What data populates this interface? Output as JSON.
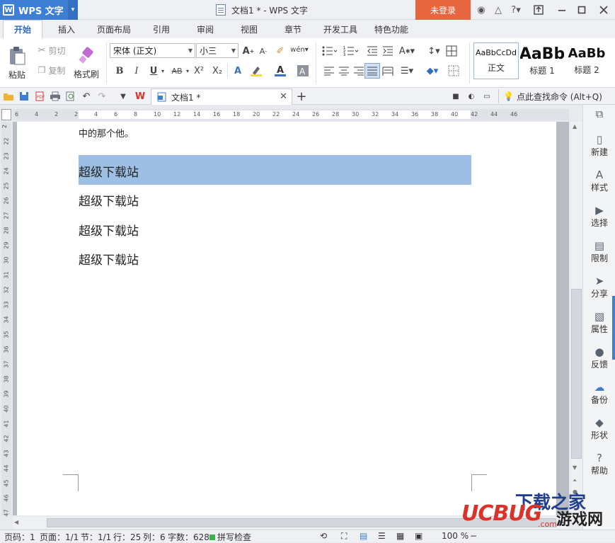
{
  "app": {
    "name": "WPS 文字",
    "doc_title": "文档1 * - WPS 文字",
    "login": "未登录"
  },
  "title_icons": [
    "shirt-icon",
    "skin-icon",
    "help-icon"
  ],
  "window": {
    "help": "?"
  },
  "tabs": [
    {
      "label": "开始",
      "active": true
    },
    {
      "label": "插入"
    },
    {
      "label": "页面布局"
    },
    {
      "label": "引用"
    },
    {
      "label": "审阅"
    },
    {
      "label": "视图"
    },
    {
      "label": "章节"
    },
    {
      "label": "开发工具"
    },
    {
      "label": "特色功能"
    }
  ],
  "ribbon": {
    "paste": "粘贴",
    "cut": "剪切",
    "copy": "复制",
    "format_painter": "格式刷",
    "font_name": "宋体 (正文)",
    "font_size": "小三",
    "bold": "B",
    "italic": "I",
    "underline": "U",
    "strike": "AB",
    "superscript": "X²",
    "subscript": "X₂",
    "styles": [
      {
        "preview": "AaBbCcDd",
        "name": "正文"
      },
      {
        "preview": "AaBb",
        "name": "标题 1"
      },
      {
        "preview": "AaBb",
        "name": "标题 2"
      }
    ]
  },
  "doc_tab": {
    "label": "文档1 *"
  },
  "search_command": "点此查找命令 (Alt+Q)",
  "ruler": {
    "h_ticks": [
      "6",
      "4",
      "2",
      "2",
      "4",
      "6",
      "8",
      "10",
      "12",
      "14",
      "16",
      "18",
      "20",
      "22",
      "24",
      "26",
      "28",
      "30",
      "32",
      "34",
      "36",
      "38",
      "40",
      "42",
      "44",
      "46"
    ],
    "v_ticks": [
      "2",
      "22",
      "23",
      "24",
      "25",
      "26",
      "27",
      "28",
      "29",
      "30",
      "31",
      "32",
      "33",
      "34",
      "35",
      "36",
      "37",
      "38",
      "39",
      "40",
      "41",
      "42",
      "43",
      "44",
      "45",
      "46",
      "47"
    ]
  },
  "document": {
    "lines": [
      "中的那个他。",
      "超级下载站",
      "超级下载站",
      "超级下载站",
      "超级下载站"
    ]
  },
  "right_panel": [
    {
      "label": "新建",
      "icon": "new-doc-icon"
    },
    {
      "label": "样式",
      "icon": "style-icon"
    },
    {
      "label": "选择",
      "icon": "select-icon"
    },
    {
      "label": "限制",
      "icon": "restrict-icon"
    },
    {
      "label": "分享",
      "icon": "share-icon"
    },
    {
      "label": "属性",
      "icon": "properties-icon"
    },
    {
      "label": "反馈",
      "icon": "feedback-icon"
    },
    {
      "label": "备份",
      "icon": "backup-icon"
    },
    {
      "label": "形状",
      "icon": "shape-icon"
    },
    {
      "label": "帮助",
      "icon": "help-icon"
    }
  ],
  "status": {
    "page_code": "页码：1",
    "page": "页面：1/1",
    "section": "节：1/1",
    "row": "行：25",
    "col": "列：6",
    "word_count": "字数：628",
    "spellcheck": "拼写检查",
    "zoom": "100 %"
  },
  "watermark": {
    "brand": "下载之家",
    "logo": "UCBUG",
    "sub": "游戏网",
    "url": ".com"
  },
  "colors": {
    "accent": "#3d7fd4",
    "login": "#e8663d",
    "highlight": "#9dbfe3"
  }
}
